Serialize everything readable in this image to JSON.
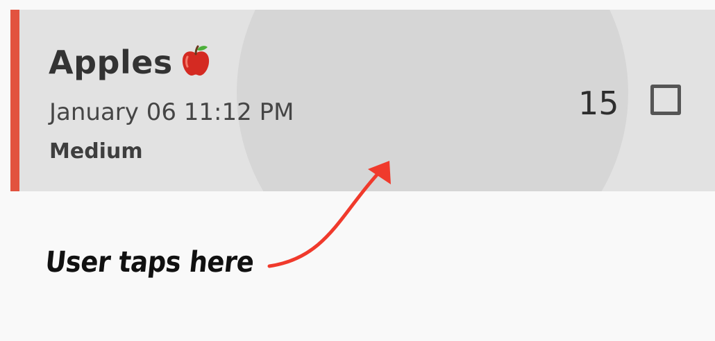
{
  "list_item": {
    "title": "Apples",
    "title_icon": "apple-emoji-icon",
    "date": "January 06 11:12 PM",
    "priority": "Medium",
    "quantity": "15",
    "checked": false,
    "priority_color": "#e2533f"
  },
  "annotation": {
    "text": "User taps here",
    "arrow_color": "#f03a2c"
  }
}
